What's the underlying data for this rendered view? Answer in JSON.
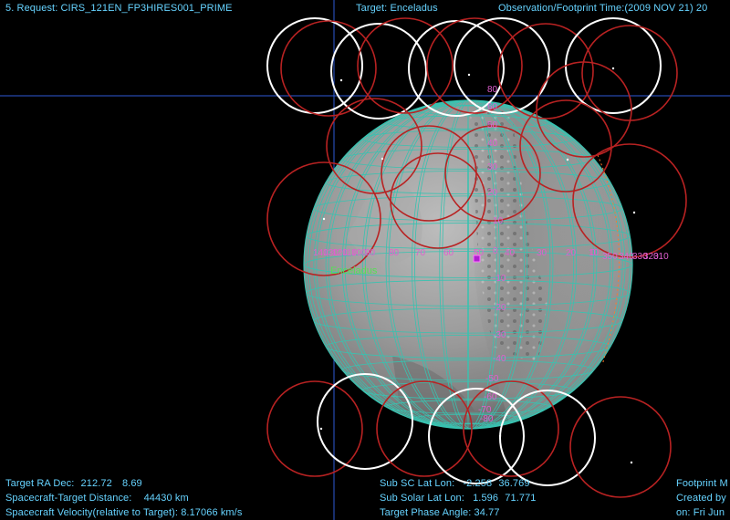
{
  "header": {
    "request": "5. Request: CIRS_121EN_FP3HIRES001_PRIME",
    "target": "Target: Enceladus",
    "time": "Observation/Footprint Time:(2009 NOV 21) 20"
  },
  "body_label": "Enceladus",
  "latitude_labels": [
    "80",
    "60",
    "50",
    "40",
    "30",
    "20",
    "10",
    "0",
    "-10",
    "-20",
    "-30",
    "-40",
    "-50",
    "-60",
    "-70",
    "-80"
  ],
  "longitude_labels_left": [
    "140",
    "130",
    "120",
    "110",
    "100",
    "90",
    "80",
    "70",
    "60",
    "50",
    "40",
    "30",
    "20",
    "10",
    "0"
  ],
  "longitude_labels_right": [
    "350",
    "340",
    "330",
    "320",
    "310"
  ],
  "footer": {
    "ra_dec_label": "Target RA Dec:",
    "ra": "212.72",
    "dec": "8.69",
    "distance_label": "Spacecraft-Target Distance:",
    "distance": "44430 km",
    "velocity": "Spacecraft Velocity(relative to Target): 8.17066 km/s",
    "subsc_label": "Sub SC Lat Lon:",
    "subsc_lat": "-2.258",
    "subsc_lon": "36.769",
    "subsolar_label": "Sub Solar Lat Lon:",
    "subsolar_lat": "1.596",
    "subsolar_lon": "71.771",
    "phase": "Target Phase Angle: 34.77",
    "footprint": "Footprint M",
    "created": "Created by",
    "date": "on: Fri Jun"
  },
  "colors": {
    "text": "#66d3ff",
    "grid": "#39c2b0",
    "footprint_white": "#ffffff",
    "footprint_red": "#b82222",
    "label": "#e05fd0",
    "target_name": "#55e055",
    "marker": "#b01fcf",
    "crosshair": "#2e5ad6"
  }
}
